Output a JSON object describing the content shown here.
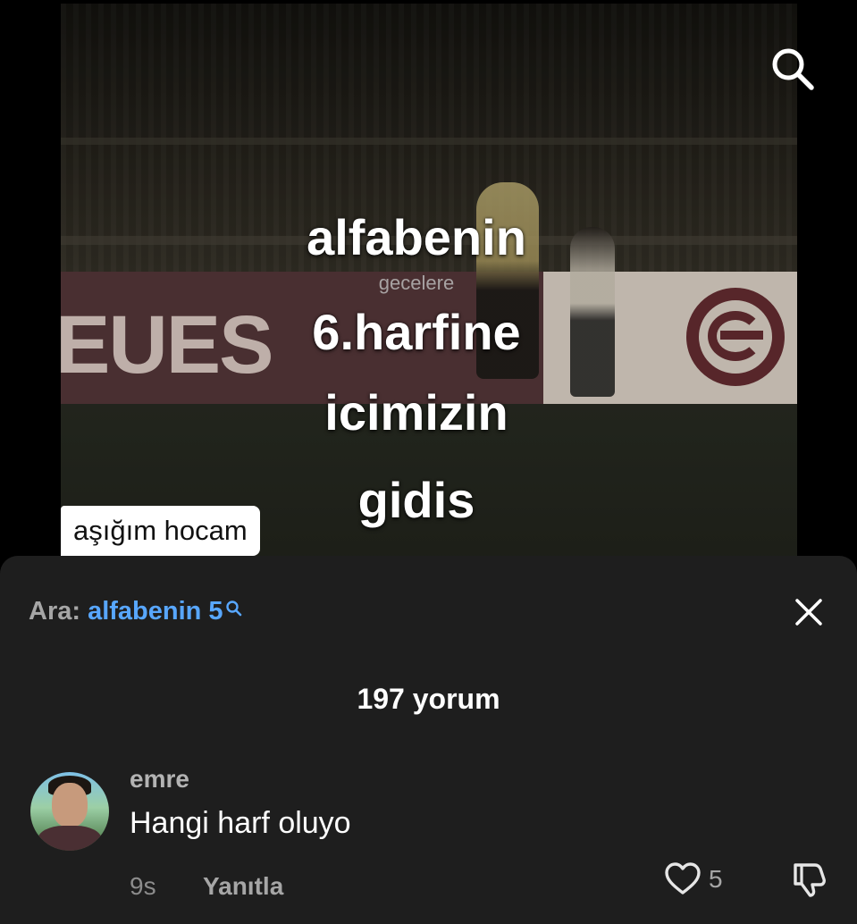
{
  "video": {
    "banner_text": "EUES",
    "overlay_lines": [
      "alfabenin",
      "6.harfine",
      "icimizin",
      "gidis"
    ],
    "overlay_small": "gecelere",
    "caption_chip": "aşığım hocam",
    "search_icon": "search-icon"
  },
  "comments_sheet": {
    "search_prefix": "Ara:",
    "search_query": "alfabenin 5",
    "close_icon": "close-icon",
    "comment_count": "197 yorum",
    "comments": [
      {
        "username": "emre",
        "text": "Hangi harf oluyo",
        "time": "9s",
        "reply_label": "Yanıtla",
        "likes": "5"
      }
    ]
  },
  "colors": {
    "sheet_bg": "#1e1e1e",
    "link_blue": "#58a7ff",
    "muted_text": "#a6a6a6"
  }
}
